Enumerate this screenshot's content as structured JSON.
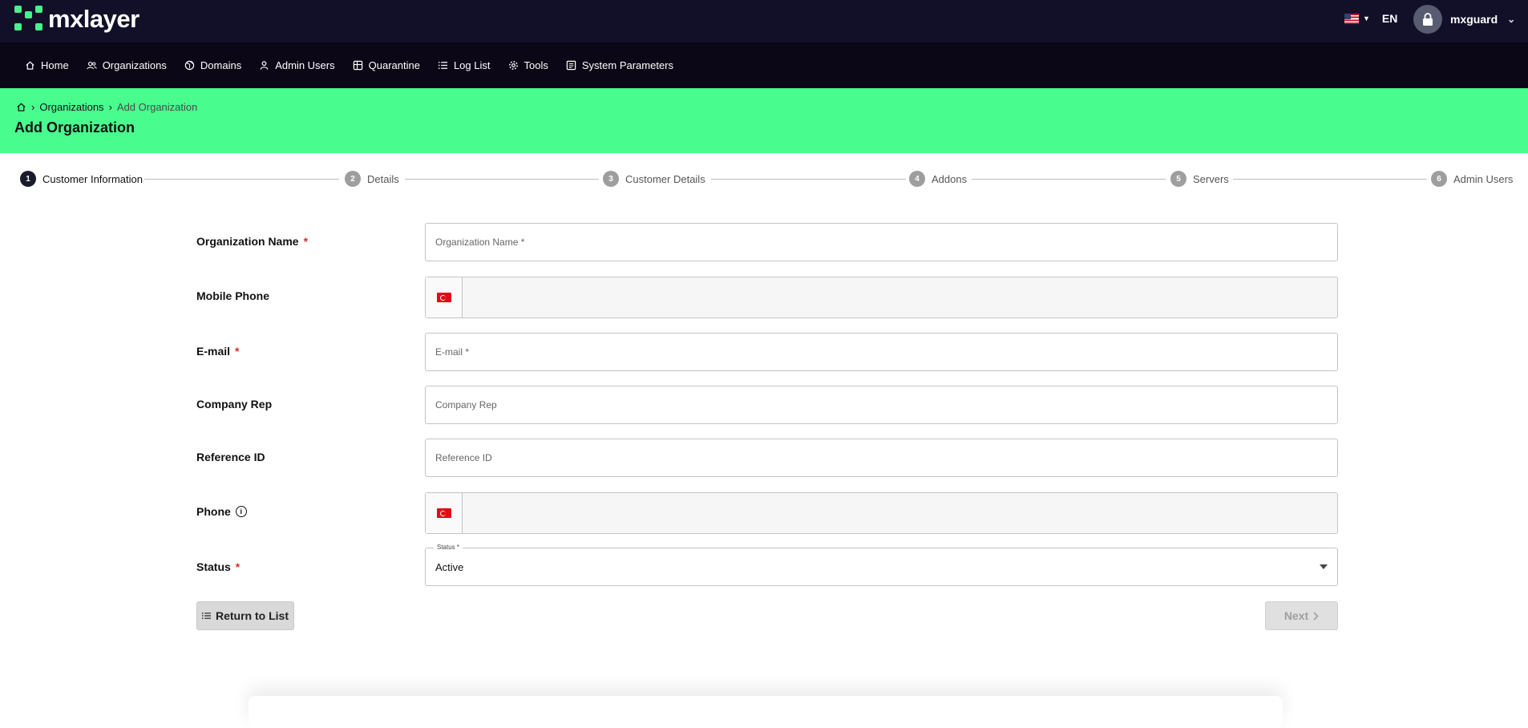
{
  "app": {
    "logo_text": "mxlayer"
  },
  "header": {
    "language": "EN",
    "username": "mxguard"
  },
  "nav": {
    "items": [
      {
        "label": "Home",
        "icon": "home-icon"
      },
      {
        "label": "Organizations",
        "icon": "users-icon"
      },
      {
        "label": "Domains",
        "icon": "globe-icon"
      },
      {
        "label": "Admin Users",
        "icon": "user-icon"
      },
      {
        "label": "Quarantine",
        "icon": "quarantine-icon"
      },
      {
        "label": "Log List",
        "icon": "list-icon"
      },
      {
        "label": "Tools",
        "icon": "gear-icon"
      },
      {
        "label": "System Parameters",
        "icon": "parameters-icon"
      }
    ]
  },
  "breadcrumb": {
    "items": [
      "Organizations",
      "Add Organization"
    ]
  },
  "page": {
    "title": "Add Organization"
  },
  "stepper": {
    "steps": [
      {
        "num": "1",
        "label": "Customer Information",
        "active": true
      },
      {
        "num": "2",
        "label": "Details",
        "active": false
      },
      {
        "num": "3",
        "label": "Customer Details",
        "active": false
      },
      {
        "num": "4",
        "label": "Addons",
        "active": false
      },
      {
        "num": "5",
        "label": "Servers",
        "active": false
      },
      {
        "num": "6",
        "label": "Admin Users",
        "active": false
      }
    ]
  },
  "form": {
    "organization_name": {
      "label": "Organization Name",
      "required": "*",
      "placeholder": "Organization Name *",
      "value": ""
    },
    "mobile_phone": {
      "label": "Mobile Phone",
      "value": ""
    },
    "email": {
      "label": "E-mail",
      "required": "*",
      "placeholder": "E-mail *",
      "value": ""
    },
    "company_rep": {
      "label": "Company Rep",
      "placeholder": "Company Rep",
      "value": ""
    },
    "reference_id": {
      "label": "Reference ID",
      "placeholder": "Reference ID",
      "value": ""
    },
    "phone": {
      "label": "Phone",
      "info": "i",
      "value": ""
    },
    "status": {
      "label": "Status",
      "required": "*",
      "legend": "Status *",
      "value": "Active"
    }
  },
  "actions": {
    "return_label": "Return to List",
    "next_label": "Next"
  },
  "colors": {
    "topbar": "#121029",
    "navbar": "#0b0716",
    "accent_green": "#48fd8e",
    "required_red": "#d32f2f"
  }
}
